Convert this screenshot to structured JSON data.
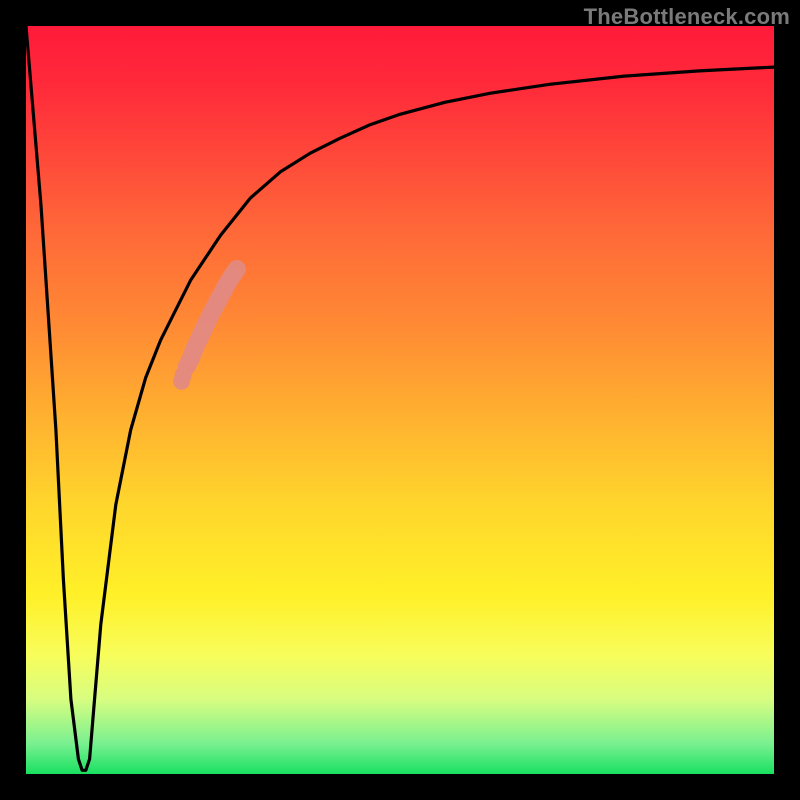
{
  "watermark": "TheBottleneck.com",
  "colors": {
    "frame": "#000000",
    "curve": "#000000",
    "marker": "#e48a80"
  },
  "chart_data": {
    "type": "line",
    "title": "",
    "xlabel": "",
    "ylabel": "",
    "xlim": [
      0,
      100
    ],
    "ylim": [
      0,
      100
    ],
    "grid": false,
    "series": [
      {
        "name": "bottleneck-curve",
        "x": [
          0,
          2,
          4,
          5,
          6,
          7,
          7.5,
          8,
          8.5,
          9,
          10,
          12,
          14,
          16,
          18,
          20,
          22,
          24,
          26,
          28,
          30,
          34,
          38,
          42,
          46,
          50,
          56,
          62,
          70,
          80,
          90,
          100
        ],
        "y": [
          100,
          76,
          46,
          26,
          10,
          2,
          0.5,
          0.5,
          2,
          8,
          20,
          36,
          46,
          53,
          58,
          62,
          66,
          69,
          72,
          74.5,
          77,
          80.5,
          83,
          85,
          86.8,
          88.2,
          89.8,
          91,
          92.2,
          93.3,
          94,
          94.5
        ]
      }
    ],
    "highlight_segment": {
      "name": "marker-band",
      "points": [
        {
          "x": 21.5,
          "y": 54.5
        },
        {
          "x": 22.0,
          "y": 55.5
        },
        {
          "x": 22.6,
          "y": 57.0
        },
        {
          "x": 23.3,
          "y": 58.5
        },
        {
          "x": 24.1,
          "y": 60.2
        },
        {
          "x": 25.0,
          "y": 62.0
        },
        {
          "x": 25.8,
          "y": 63.5
        },
        {
          "x": 26.7,
          "y": 65.2
        },
        {
          "x": 27.5,
          "y": 66.5
        },
        {
          "x": 28.2,
          "y": 67.5
        }
      ]
    }
  }
}
